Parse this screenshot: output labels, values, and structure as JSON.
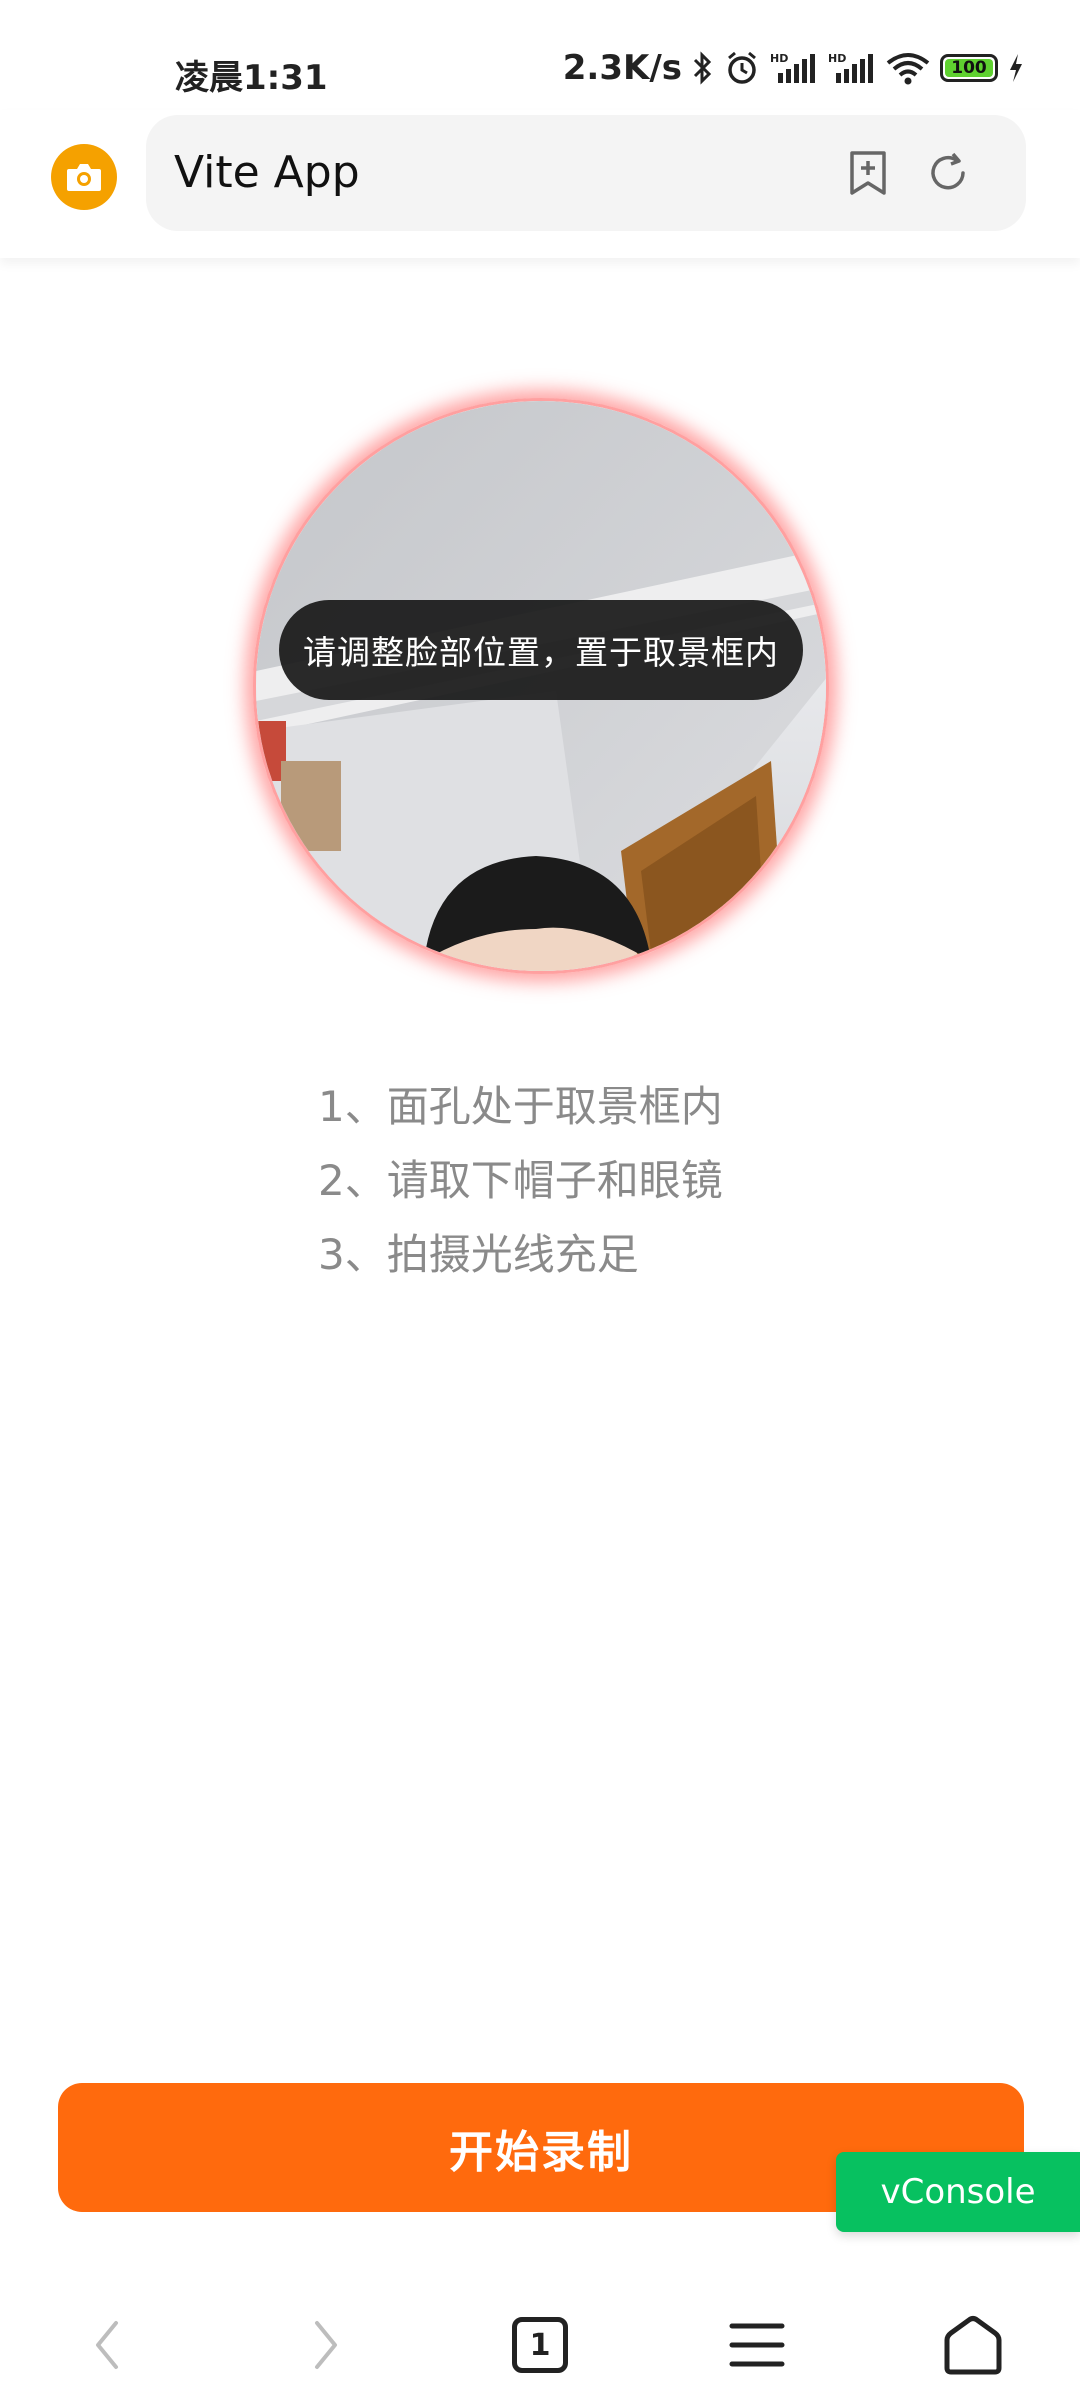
{
  "status_bar": {
    "time": "凌晨1:31",
    "net_speed": "2.3K/s",
    "battery": "100"
  },
  "browser": {
    "url_title": "Vite App"
  },
  "camera": {
    "hint": "请调整脸部位置，置于取景框内",
    "glow_color": "#ff5a5a"
  },
  "instructions": [
    "1、面孔处于取景框内",
    "2、请取下帽子和眼镜",
    "3、拍摄光线充足"
  ],
  "record_button": {
    "label": "开始录制",
    "color": "#ff6a0d"
  },
  "vconsole": {
    "label": "vConsole",
    "color": "#07c160"
  },
  "bottom_nav": {
    "tab_count": "1"
  }
}
